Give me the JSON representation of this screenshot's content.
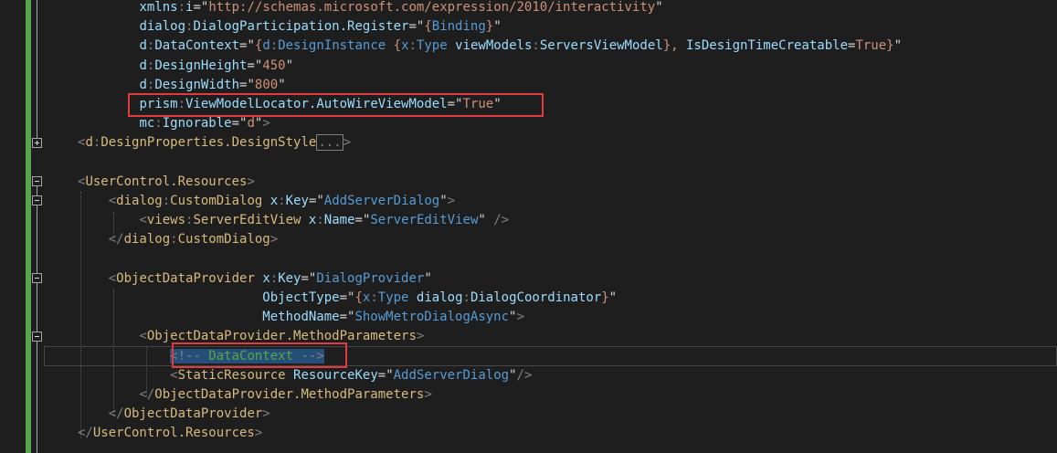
{
  "editor": {
    "lines": [
      {
        "indent": "        ",
        "parts": [
          [
            "t-at",
            "xmlns"
          ],
          [
            "t-col",
            ":"
          ],
          [
            "t-at",
            "i"
          ],
          [
            "t-op",
            "=\""
          ],
          [
            "t-val",
            "http://schemas.microsoft.com/expression/2010/interactivity"
          ],
          [
            "t-op",
            "\""
          ]
        ]
      },
      {
        "indent": "        ",
        "parts": [
          [
            "t-at",
            "dialog"
          ],
          [
            "t-col",
            ":"
          ],
          [
            "t-at",
            "DialogParticipation.Register"
          ],
          [
            "t-op",
            "=\""
          ],
          [
            "t-val",
            "{"
          ],
          [
            "t-pf",
            "Binding"
          ],
          [
            "t-val",
            "}"
          ],
          [
            "t-op",
            "\""
          ]
        ]
      },
      {
        "indent": "        ",
        "parts": [
          [
            "t-at",
            "d"
          ],
          [
            "t-col",
            ":"
          ],
          [
            "t-at",
            "DataContext"
          ],
          [
            "t-op",
            "=\""
          ],
          [
            "t-val",
            "{"
          ],
          [
            "t-pf",
            "d"
          ],
          [
            "t-col",
            ":"
          ],
          [
            "t-pf",
            "DesignInstance"
          ],
          [
            "t-val",
            " {"
          ],
          [
            "t-pf",
            "x"
          ],
          [
            "t-col",
            ":"
          ],
          [
            "t-pf",
            "Type"
          ],
          [
            "t-val",
            " "
          ],
          [
            "t-at",
            "viewModels"
          ],
          [
            "t-col",
            ":"
          ],
          [
            "t-at",
            "ServersViewModel"
          ],
          [
            "t-val",
            "}, "
          ],
          [
            "t-at",
            "IsDesignTimeCreatable"
          ],
          [
            "t-op",
            "="
          ],
          [
            "t-val",
            "True}"
          ],
          [
            "t-op",
            "\""
          ]
        ]
      },
      {
        "indent": "        ",
        "parts": [
          [
            "t-at",
            "d"
          ],
          [
            "t-col",
            ":"
          ],
          [
            "t-at",
            "DesignHeight"
          ],
          [
            "t-op",
            "=\""
          ],
          [
            "t-val",
            "450"
          ],
          [
            "t-op",
            "\""
          ]
        ]
      },
      {
        "indent": "        ",
        "parts": [
          [
            "t-at",
            "d"
          ],
          [
            "t-col",
            ":"
          ],
          [
            "t-at",
            "DesignWidth"
          ],
          [
            "t-op",
            "=\""
          ],
          [
            "t-val",
            "800"
          ],
          [
            "t-op",
            "\""
          ]
        ]
      },
      {
        "indent": "        ",
        "parts": [
          [
            "t-at",
            "prism"
          ],
          [
            "t-col",
            ":"
          ],
          [
            "t-at",
            "ViewModelLocator.AutoWireViewModel"
          ],
          [
            "t-op",
            "=\""
          ],
          [
            "t-val",
            "True"
          ],
          [
            "t-op",
            "\""
          ]
        ]
      },
      {
        "indent": "        ",
        "parts": [
          [
            "t-at",
            "mc"
          ],
          [
            "t-col",
            ":"
          ],
          [
            "t-at",
            "Ignorable"
          ],
          [
            "t-op",
            "=\""
          ],
          [
            "t-val",
            "d"
          ],
          [
            "t-op",
            "\""
          ],
          [
            "t-br",
            ">"
          ]
        ]
      },
      {
        "indent": "",
        "parts": [
          [
            "t-br",
            "<"
          ],
          [
            "t-el",
            "d"
          ],
          [
            "t-col",
            ":"
          ],
          [
            "t-el",
            "DesignProperties.DesignStyle"
          ]
        ],
        "collapsed": "...",
        "after": ">"
      },
      {
        "indent": "",
        "parts": []
      },
      {
        "indent": "",
        "parts": [
          [
            "t-br",
            "<"
          ],
          [
            "t-el",
            "UserControl.Resources"
          ],
          [
            "t-br",
            ">"
          ]
        ]
      },
      {
        "indent": "    ",
        "parts": [
          [
            "t-br",
            "<"
          ],
          [
            "t-el",
            "dialog"
          ],
          [
            "t-col",
            ":"
          ],
          [
            "t-el",
            "CustomDialog"
          ],
          [
            "t-op",
            " "
          ],
          [
            "t-at",
            "x"
          ],
          [
            "t-col",
            ":"
          ],
          [
            "t-at",
            "Key"
          ],
          [
            "t-op",
            "=\""
          ],
          [
            "t-pf",
            "AddServerDialog"
          ],
          [
            "t-op",
            "\""
          ],
          [
            "t-br",
            ">"
          ]
        ]
      },
      {
        "indent": "        ",
        "parts": [
          [
            "t-br",
            "<"
          ],
          [
            "t-el",
            "views"
          ],
          [
            "t-col",
            ":"
          ],
          [
            "t-el",
            "ServerEditView"
          ],
          [
            "t-op",
            " "
          ],
          [
            "t-at",
            "x"
          ],
          [
            "t-col",
            ":"
          ],
          [
            "t-at",
            "Name"
          ],
          [
            "t-op",
            "=\""
          ],
          [
            "t-pf",
            "ServerEditView"
          ],
          [
            "t-op",
            "\""
          ],
          [
            "t-br",
            " />"
          ]
        ]
      },
      {
        "indent": "    ",
        "parts": [
          [
            "t-br",
            "</"
          ],
          [
            "t-el",
            "dialog"
          ],
          [
            "t-col",
            ":"
          ],
          [
            "t-el",
            "CustomDialog"
          ],
          [
            "t-br",
            ">"
          ]
        ]
      },
      {
        "indent": "",
        "parts": []
      },
      {
        "indent": "    ",
        "parts": [
          [
            "t-br",
            "<"
          ],
          [
            "t-el",
            "ObjectDataProvider"
          ],
          [
            "t-op",
            " "
          ],
          [
            "t-at",
            "x"
          ],
          [
            "t-col",
            ":"
          ],
          [
            "t-at",
            "Key"
          ],
          [
            "t-op",
            "=\""
          ],
          [
            "t-pf",
            "DialogProvider"
          ],
          [
            "t-op",
            "\""
          ]
        ]
      },
      {
        "indent": "                        ",
        "parts": [
          [
            "t-at",
            "ObjectType"
          ],
          [
            "t-op",
            "=\""
          ],
          [
            "t-val",
            "{"
          ],
          [
            "t-pf",
            "x"
          ],
          [
            "t-col",
            ":"
          ],
          [
            "t-pf",
            "Type"
          ],
          [
            "t-val",
            " "
          ],
          [
            "t-at",
            "dialog"
          ],
          [
            "t-col",
            ":"
          ],
          [
            "t-at",
            "DialogCoordinator"
          ],
          [
            "t-val",
            "}"
          ],
          [
            "t-op",
            "\""
          ]
        ]
      },
      {
        "indent": "                        ",
        "parts": [
          [
            "t-at",
            "MethodName"
          ],
          [
            "t-op",
            "=\""
          ],
          [
            "t-pf",
            "ShowMetroDialogAsync"
          ],
          [
            "t-op",
            "\""
          ],
          [
            "t-br",
            ">"
          ]
        ]
      },
      {
        "indent": "        ",
        "parts": [
          [
            "t-br",
            "<"
          ],
          [
            "t-el",
            "ObjectDataProvider.MethodParameters"
          ],
          [
            "t-br",
            ">"
          ]
        ]
      },
      {
        "indent": "            ",
        "parts": [
          [
            "t-br",
            "<!--"
          ],
          [
            "t-cm",
            " DataContext "
          ],
          [
            "t-br",
            "-->"
          ]
        ],
        "comment": true
      },
      {
        "indent": "            ",
        "parts": [
          [
            "t-br",
            "<"
          ],
          [
            "t-el",
            "StaticResource"
          ],
          [
            "t-op",
            " "
          ],
          [
            "t-at",
            "ResourceKey"
          ],
          [
            "t-op",
            "=\""
          ],
          [
            "t-pf",
            "AddServerDialog"
          ],
          [
            "t-op",
            "\""
          ],
          [
            "t-br",
            "/>"
          ]
        ]
      },
      {
        "indent": "        ",
        "parts": [
          [
            "t-br",
            "</"
          ],
          [
            "t-el",
            "ObjectDataProvider.MethodParameters"
          ],
          [
            "t-br",
            ">"
          ]
        ]
      },
      {
        "indent": "    ",
        "parts": [
          [
            "t-br",
            "</"
          ],
          [
            "t-el",
            "ObjectDataProvider"
          ],
          [
            "t-br",
            ">"
          ]
        ]
      },
      {
        "indent": "",
        "parts": [
          [
            "t-br",
            "</"
          ],
          [
            "t-el",
            "UserControl.Resources"
          ],
          [
            "t-br",
            ">"
          ]
        ]
      }
    ],
    "colors": {
      "background": "#1e1e1e",
      "change_bar": "#57a64a",
      "highlight": "#e13a3f"
    }
  }
}
